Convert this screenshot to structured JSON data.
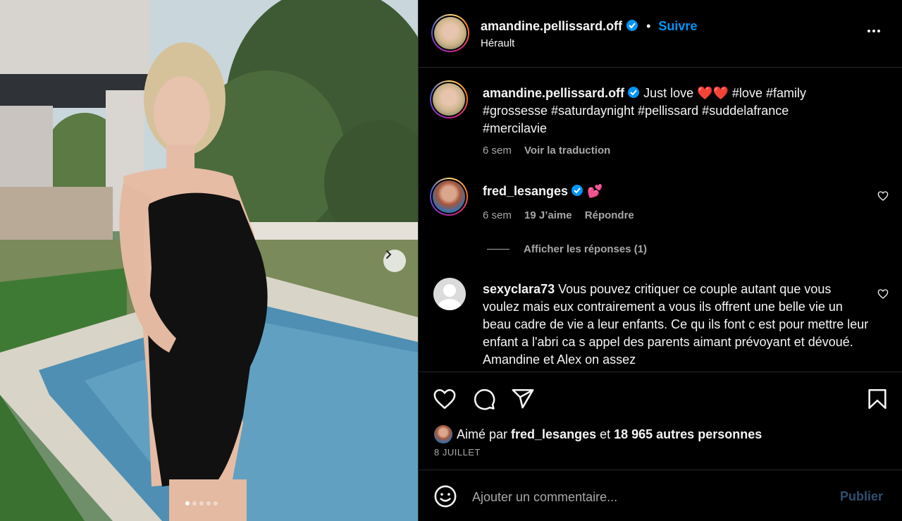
{
  "post": {
    "author": "amandine.pellissard.off",
    "follow_label": "Suivre",
    "separator": "•",
    "location": "Hérault",
    "slide_count": 5,
    "active_slide": 1
  },
  "caption": {
    "author": "amandine.pellissard.off",
    "text": " Just love ❤️❤️ #love #family #grossesse #saturdaynight #pellissard #suddelafrance #mercilavie",
    "time": "6 sem",
    "translate_label": "Voir la traduction"
  },
  "comments": [
    {
      "author": "fred_lesanges",
      "text": " 💕",
      "time": "6 sem",
      "likes": "19 J’aime",
      "reply_label": "Répondre",
      "view_replies": "Afficher les réponses (1)"
    },
    {
      "author": "sexyclara73",
      "text": " Vous pouvez critiquer ce couple autant que vous voulez mais eux contrairement a vous ils offrent une belle vie un beau cadre de vie a leur enfants. Ce qu ils font c est pour mettre leur enfant a l'abri ca s appel des parents aimant prévoyant et dévoué. Amandine et Alex on assez"
    }
  ],
  "likes": {
    "prefix": "Aimé par ",
    "user": "fred_lesanges",
    "middle": " et ",
    "count": "18 965 autres personnes"
  },
  "date": "8 JUILLET",
  "add_comment": {
    "placeholder": "Ajouter un commentaire...",
    "publish_label": "Publier"
  },
  "colors": {
    "accent": "#0095f6",
    "background": "#000000",
    "verified": "#0095f6"
  },
  "icons": [
    "chevron-right-icon",
    "more-icon",
    "verified-icon",
    "heart-icon",
    "comment-icon",
    "share-icon",
    "bookmark-icon",
    "emoji-icon"
  ]
}
